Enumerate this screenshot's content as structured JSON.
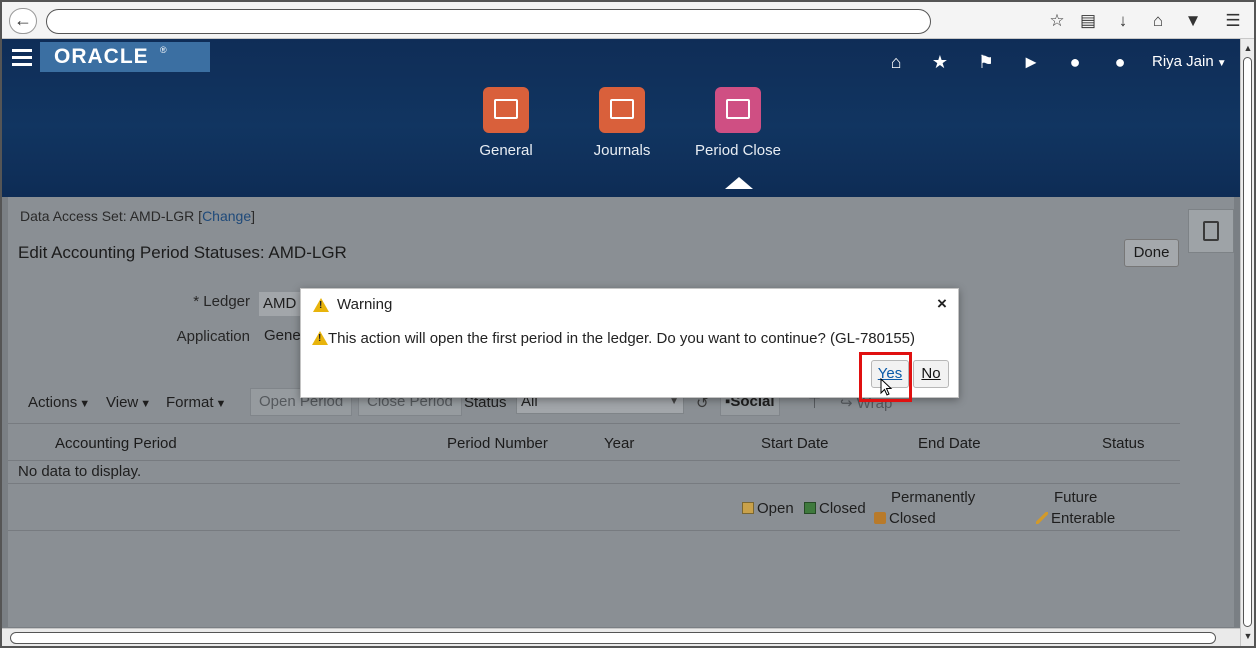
{
  "browser": {
    "back_icon": "arrow-left-icon",
    "toolbar_icons": [
      "star-icon",
      "reading-list-icon",
      "download-icon",
      "home-icon",
      "pocket-icon",
      "menu-icon"
    ]
  },
  "header": {
    "logo": "ORACLE",
    "logo_reg": "®",
    "user": "Riya Jain",
    "icons": [
      "home-icon",
      "favorites-star-icon",
      "flag-icon",
      "notifications-icon",
      "accessibility-icon",
      "help-icon"
    ],
    "tiles": [
      {
        "label": "General",
        "color": "#d9603b"
      },
      {
        "label": "Journals",
        "color": "#d9603b"
      },
      {
        "label": "Period Close",
        "color": "#cf4f83"
      }
    ]
  },
  "page": {
    "das_prefix": "Data Access Set: AMD-LGR [",
    "das_change": "Change",
    "das_suffix": "]",
    "title": "Edit Accounting Period Statuses: AMD-LGR",
    "done_label": "Done",
    "ledger_label": "* Ledger",
    "ledger_value": "AMD",
    "application_label": "Application",
    "application_value": "Gene"
  },
  "toolbar": {
    "actions": "Actions",
    "view": "View",
    "format": "Format",
    "open_period": "Open Period",
    "close_period": "Close Period",
    "status_label": "Status",
    "status_value": "All",
    "social": "Social",
    "wrap": "Wrap"
  },
  "table": {
    "columns": [
      "Accounting Period",
      "Period Number",
      "Year",
      "Start Date",
      "End Date",
      "Status"
    ],
    "empty_text": "No data to display."
  },
  "legend": {
    "open": "Open",
    "closed": "Closed",
    "permanently": "Permanently",
    "permanently_closed": "Closed",
    "future": "Future",
    "future_enterable": "Enterable"
  },
  "modal": {
    "title": "Warning",
    "message": "This action will open the first period in the ledger. Do you want to continue? (GL-780155)",
    "yes": "Yes",
    "no": "No",
    "close": "×"
  },
  "colors": {
    "header_bg": "#113561",
    "warning": "#e8b40c",
    "highlight": "#e01010",
    "yes_text": "#0a5aa8"
  }
}
